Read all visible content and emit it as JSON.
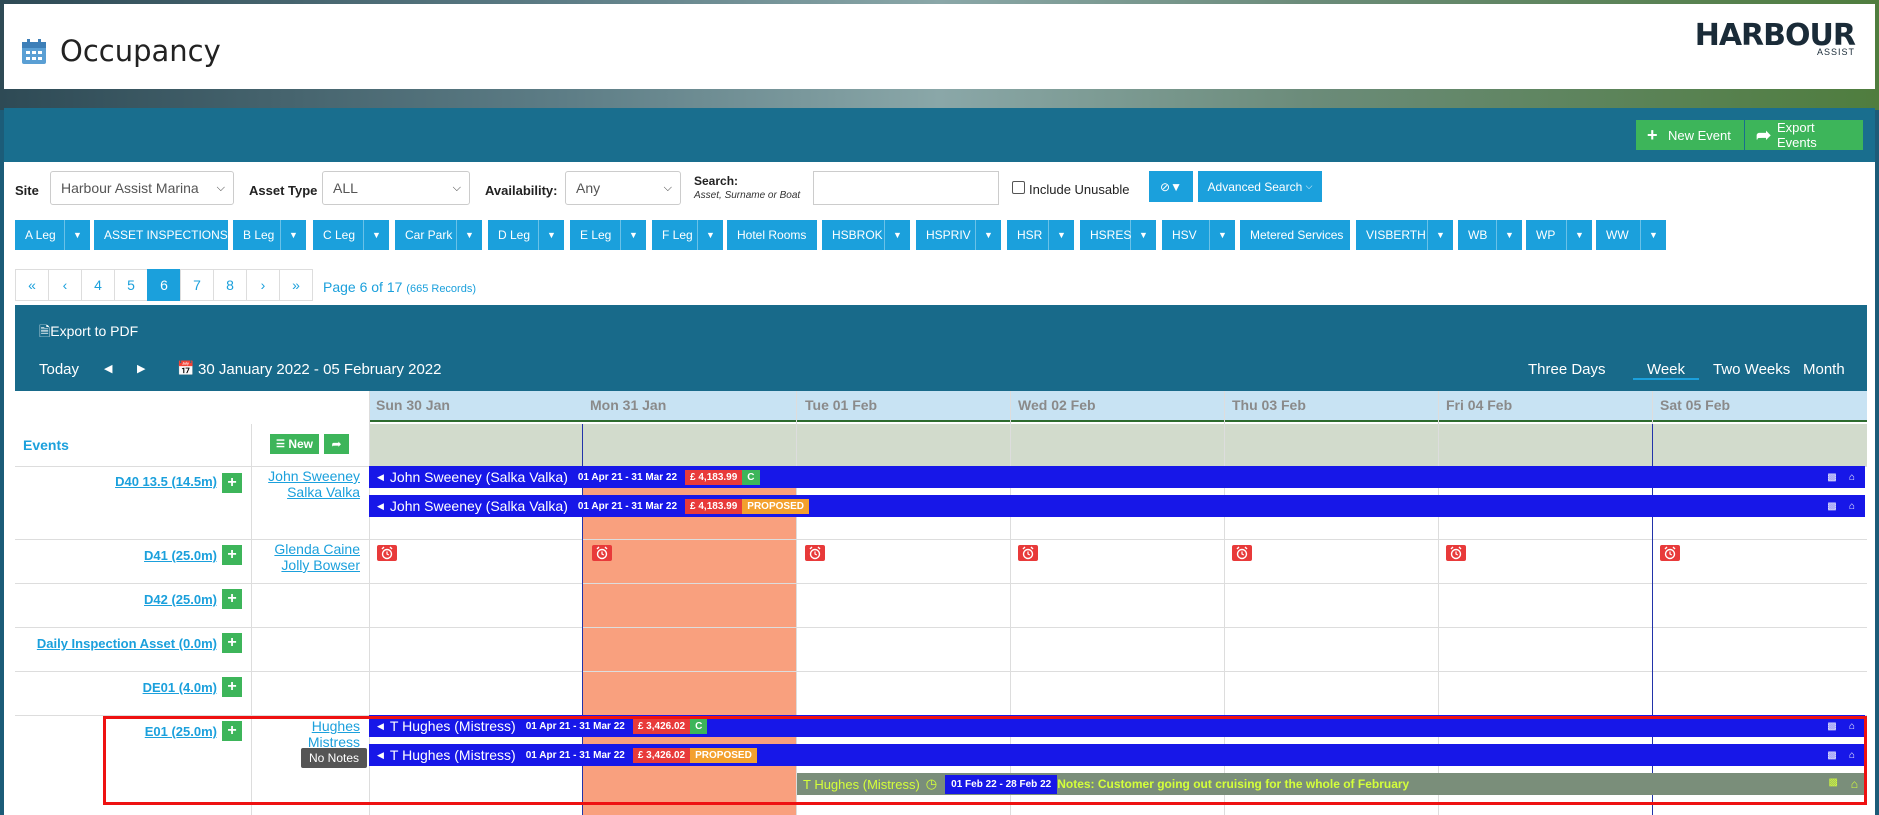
{
  "header": {
    "title": "Occupancy",
    "logo_main": "HARBOUR",
    "logo_sub": "ASSIST"
  },
  "actions": {
    "new_event": "New Event",
    "export_events": "Export Events"
  },
  "filters": {
    "site_label": "Site",
    "site_value": "Harbour Assist Marina",
    "asset_type_label": "Asset Type",
    "asset_type_value": "ALL",
    "availability_label": "Availability:",
    "availability_value": "Any",
    "search_label": "Search:",
    "search_sub": "Asset, Surname or Boat",
    "search_value": "",
    "include_unusable": "Include Unusable",
    "advanced_search": "Advanced Search"
  },
  "legs": [
    {
      "label": "A Leg",
      "dropdown": true
    },
    {
      "label": "ASSET INSPECTIONS",
      "dropdown": false
    },
    {
      "label": "B Leg",
      "dropdown": true
    },
    {
      "label": "C Leg",
      "dropdown": true
    },
    {
      "label": "Car Park",
      "dropdown": true
    },
    {
      "label": "D Leg",
      "dropdown": true
    },
    {
      "label": "E Leg",
      "dropdown": true
    },
    {
      "label": "F Leg",
      "dropdown": true
    },
    {
      "label": "Hotel Rooms",
      "dropdown": false
    },
    {
      "label": "HSBROK",
      "dropdown": true
    },
    {
      "label": "HSPRIV",
      "dropdown": true
    },
    {
      "label": "HSR",
      "dropdown": true
    },
    {
      "label": "HSRES",
      "dropdown": true
    },
    {
      "label": "HSV",
      "dropdown": true
    },
    {
      "label": "Metered Services",
      "dropdown": false
    },
    {
      "label": "VISBERTH",
      "dropdown": true
    },
    {
      "label": "WB",
      "dropdown": true
    },
    {
      "label": "WP",
      "dropdown": true
    },
    {
      "label": "WW",
      "dropdown": true
    }
  ],
  "pagination": {
    "pages": [
      "«",
      "‹",
      "4",
      "5",
      "6",
      "7",
      "8",
      "›",
      "»"
    ],
    "active": "6",
    "info": "Page 6 of 17",
    "records": "(665 Records)"
  },
  "calendar": {
    "export_pdf": "Export to PDF",
    "today": "Today",
    "range": "30 January 2022 - 05 February 2022",
    "views": [
      "Three Days",
      "Week",
      "Two Weeks",
      "Month"
    ],
    "active_view": "Week",
    "days": [
      "Sun 30 Jan",
      "Mon 31 Jan",
      "Tue 01 Feb",
      "Wed 02 Feb",
      "Thu 03 Feb",
      "Fri 04 Feb",
      "Sat 05 Feb"
    ],
    "events_label": "Events",
    "new_label": "New"
  },
  "assets": [
    {
      "name": "D40 13.5 (14.5m)",
      "owner": "John Sweeney",
      "boat": "Salka Valka"
    },
    {
      "name": "D41 (25.0m)",
      "owner": "Glenda Caine",
      "boat": "Jolly Bowser"
    },
    {
      "name": "D42 (25.0m)"
    },
    {
      "name": "Daily Inspection Asset (0.0m)"
    },
    {
      "name": "DE01 (4.0m)"
    },
    {
      "name": "E01 (25.0m)",
      "owner": "Hughes",
      "boat": "Mistress"
    }
  ],
  "bookings": [
    {
      "name": "John Sweeney (Salka Valka)",
      "dates": "01 Apr 21 - 31 Mar 22",
      "price": "£ 4,183.99",
      "status": "C"
    },
    {
      "name": "John Sweeney (Salka Valka)",
      "dates": "01 Apr 21 - 31 Mar 22",
      "price": "£ 4,183.99",
      "status": "PROPOSED"
    },
    {
      "name": "T Hughes (Mistress)",
      "dates": "01 Apr 21 - 31 Mar 22",
      "price": "£ 3,426.02",
      "status": "C"
    },
    {
      "name": "T Hughes (Mistress)",
      "dates": "01 Apr 21 - 31 Mar 22",
      "price": "£ 3,426.02",
      "status": "PROPOSED"
    },
    {
      "name": "T Hughes (Mistress)",
      "dates": "01 Feb 22 - 28 Feb 22",
      "notes": "Notes: Customer going out cruising for the whole of February"
    }
  ],
  "tooltip": "No Notes",
  "colors": {
    "brand_dark": "#186a8a",
    "accent_blue": "#1ba0dc",
    "green": "#3db55a",
    "booking_blue": "#1717e8",
    "price_red": "#e83a3a",
    "proposed_orange": "#f3a02e",
    "today_highlight": "#f9a07e"
  }
}
